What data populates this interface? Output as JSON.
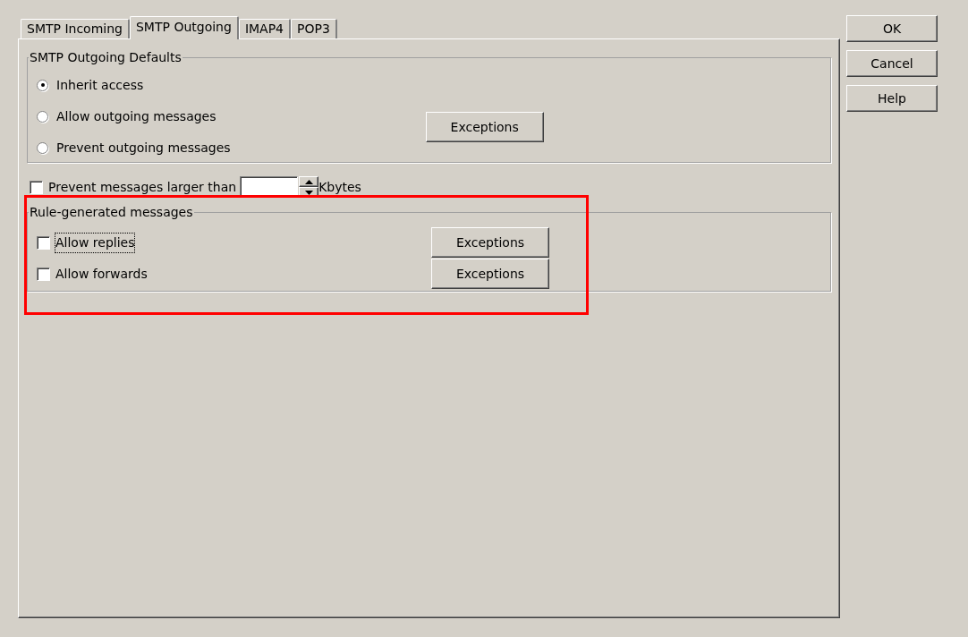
{
  "tabs": [
    {
      "label": "SMTP Incoming",
      "selected": false
    },
    {
      "label": "SMTP Outgoing",
      "selected": true
    },
    {
      "label": "IMAP4",
      "selected": false
    },
    {
      "label": "POP3",
      "selected": false
    }
  ],
  "defaults_group": {
    "title": "SMTP Outgoing Defaults",
    "options": [
      {
        "label": "Inherit access",
        "selected": true
      },
      {
        "label": "Allow outgoing messages",
        "selected": false
      },
      {
        "label": "Prevent outgoing messages",
        "selected": false
      }
    ],
    "button": "Exceptions"
  },
  "size_limit": {
    "label": "Prevent messages larger than",
    "checked": false,
    "unit": "Kbytes"
  },
  "rule_group": {
    "title": "Rule-generated messages",
    "highlighted": true,
    "items": [
      {
        "label": "Allow replies",
        "checked": false,
        "focused": true,
        "button": "Exceptions"
      },
      {
        "label": "Allow forwards",
        "checked": false,
        "focused": false,
        "button": "Exceptions"
      }
    ]
  },
  "buttons": [
    "OK",
    "Cancel",
    "Help"
  ]
}
